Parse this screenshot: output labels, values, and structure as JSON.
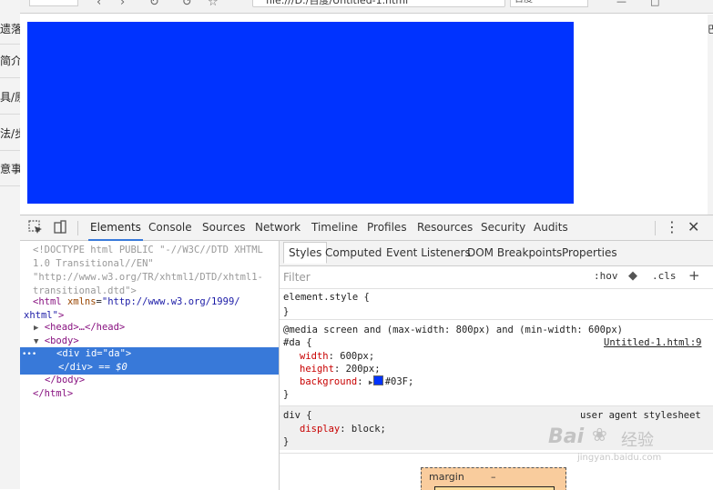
{
  "background_page": {
    "left_fragments": [
      "遗落",
      "简介",
      "具/原",
      "法/步",
      "意事"
    ],
    "right_fragment": "巴"
  },
  "browser": {
    "address": "file:///D:/百度/Untitled-1.html",
    "extension_badge": "百度"
  },
  "page_preview": {
    "box_color": "#0033FF"
  },
  "devtools": {
    "tabs": [
      "Elements",
      "Console",
      "Sources",
      "Network",
      "Timeline",
      "Profiles",
      "Resources",
      "Security",
      "Audits"
    ],
    "active_tab": "Elements",
    "dom_tree": {
      "doctype_1": "<!DOCTYPE html PUBLIC \"-//W3C//DTD XHTML",
      "doctype_2": "1.0 Transitional//EN\"",
      "doctype_3": "\"http://www.w3.org/TR/xhtml1/DTD/xhtml1-",
      "doctype_4": "transitional.dtd\">",
      "html_open_tag": "<html",
      "html_attr": "xmlns",
      "html_val_1": "\"http://www.w3.org/1999/",
      "html_val_2": "xhtml\"",
      "html_close_bracket": ">",
      "head_collapsed": "<head>…</head>",
      "body_open": "<body>",
      "div_open": "<div",
      "div_attr": "id",
      "div_val": "\"da\"",
      "div_gt": ">",
      "div_close": "</div>",
      "selected_marker": "== $0",
      "ellipsis": "•••",
      "body_close": "</body>",
      "html_close": "</html>"
    },
    "styles_pane": {
      "tabs": [
        "Styles",
        "Computed",
        "Event Listeners",
        "DOM Breakpoints",
        "Properties"
      ],
      "active_tab": "Styles",
      "filter_placeholder": "Filter",
      "hov_label": ":hov",
      "cls_label": ".cls",
      "element_style": "element.style {",
      "close_brace": "}",
      "media_query": "@media screen and (max-width: 800px) and (min-width: 600px)",
      "selector_da": "#da {",
      "source_link": "Untitled-1.html:9",
      "props": [
        {
          "name": "width",
          "value": "600px;"
        },
        {
          "name": "height",
          "value": "200px;"
        },
        {
          "name": "background",
          "value": "#03F;"
        }
      ],
      "swatch_color": "#0033FF",
      "ua_selector": "div {",
      "ua_label": "user agent stylesheet",
      "ua_prop_name": "display",
      "ua_prop_value": "block;",
      "box_model_label": "margin",
      "box_model_value": "–"
    }
  },
  "watermark": {
    "brand": "Bai",
    "brand_cjk": "经验",
    "url": "jingyan.baidu.com"
  }
}
